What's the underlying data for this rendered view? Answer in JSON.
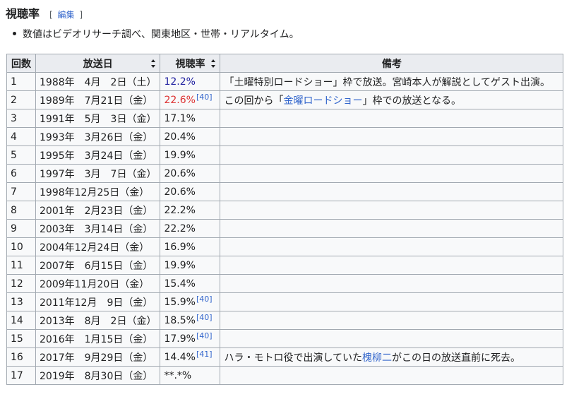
{
  "section": {
    "title": "視聴率",
    "edit_open": "[",
    "edit_label": "編集",
    "edit_close": "]"
  },
  "notes": [
    "数値はビデオリサーチ調べ、関東地区・世帯・リアルタイム。"
  ],
  "table": {
    "headers": {
      "no": "回数",
      "date": "放送日",
      "rating": "視聴率",
      "remarks": "備考"
    },
    "rows": [
      {
        "no": "1",
        "date": "1988年　4月　2日（土）",
        "rating": "12.2%",
        "ref": "",
        "remarks_pre": "「土曜特別ロードショー」枠で放送。宮崎本人が解説としてゲスト出演。",
        "remarks_link": "",
        "remarks_post": ""
      },
      {
        "no": "2",
        "date": "1989年　7月21日（金）",
        "rating": "22.6%",
        "ref": "[40]",
        "remarks_pre": "この回から「",
        "remarks_link": "金曜ロードショー",
        "remarks_post": "」枠での放送となる。"
      },
      {
        "no": "3",
        "date": "1991年　5月　3日（金）",
        "rating": "17.1%",
        "ref": "",
        "remarks_pre": "",
        "remarks_link": "",
        "remarks_post": ""
      },
      {
        "no": "4",
        "date": "1993年　3月26日（金）",
        "rating": "20.4%",
        "ref": "",
        "remarks_pre": "",
        "remarks_link": "",
        "remarks_post": ""
      },
      {
        "no": "5",
        "date": "1995年　3月24日（金）",
        "rating": "19.9%",
        "ref": "",
        "remarks_pre": "",
        "remarks_link": "",
        "remarks_post": ""
      },
      {
        "no": "6",
        "date": "1997年　3月　7日（金）",
        "rating": "20.6%",
        "ref": "",
        "remarks_pre": "",
        "remarks_link": "",
        "remarks_post": ""
      },
      {
        "no": "7",
        "date": "1998年12月25日（金）",
        "rating": "20.6%",
        "ref": "",
        "remarks_pre": "",
        "remarks_link": "",
        "remarks_post": ""
      },
      {
        "no": "8",
        "date": "2001年　2月23日（金）",
        "rating": "22.2%",
        "ref": "",
        "remarks_pre": "",
        "remarks_link": "",
        "remarks_post": ""
      },
      {
        "no": "9",
        "date": "2003年　3月14日（金）",
        "rating": "22.2%",
        "ref": "",
        "remarks_pre": "",
        "remarks_link": "",
        "remarks_post": ""
      },
      {
        "no": "10",
        "date": "2004年12月24日（金）",
        "rating": "16.9%",
        "ref": "",
        "remarks_pre": "",
        "remarks_link": "",
        "remarks_post": ""
      },
      {
        "no": "11",
        "date": "2007年　6月15日（金）",
        "rating": "19.9%",
        "ref": "",
        "remarks_pre": "",
        "remarks_link": "",
        "remarks_post": ""
      },
      {
        "no": "12",
        "date": "2009年11月20日（金）",
        "rating": "15.4%",
        "ref": "",
        "remarks_pre": "",
        "remarks_link": "",
        "remarks_post": ""
      },
      {
        "no": "13",
        "date": "2011年12月　9日（金）",
        "rating": "15.9%",
        "ref": "[40]",
        "remarks_pre": "",
        "remarks_link": "",
        "remarks_post": ""
      },
      {
        "no": "14",
        "date": "2013年　8月　2日（金）",
        "rating": "18.5%",
        "ref": "[40]",
        "remarks_pre": "",
        "remarks_link": "",
        "remarks_post": ""
      },
      {
        "no": "15",
        "date": "2016年　1月15日（金）",
        "rating": "17.9%",
        "ref": "[40]",
        "remarks_pre": "",
        "remarks_link": "",
        "remarks_post": ""
      },
      {
        "no": "16",
        "date": "2017年　9月29日（金）",
        "rating": "14.4%",
        "ref": "[41]",
        "remarks_pre": "ハラ・モトロ役で出演していた",
        "remarks_link": "槐柳二",
        "remarks_post": "がこの日の放送直前に死去。"
      },
      {
        "no": "17",
        "date": "2019年　8月30日（金）",
        "rating": "**.*%",
        "ref": "",
        "remarks_pre": "",
        "remarks_link": "",
        "remarks_post": ""
      }
    ]
  },
  "colors": {
    "min_rating": "#2020a0",
    "max_rating": "#dd3333",
    "link": "#3366cc"
  }
}
